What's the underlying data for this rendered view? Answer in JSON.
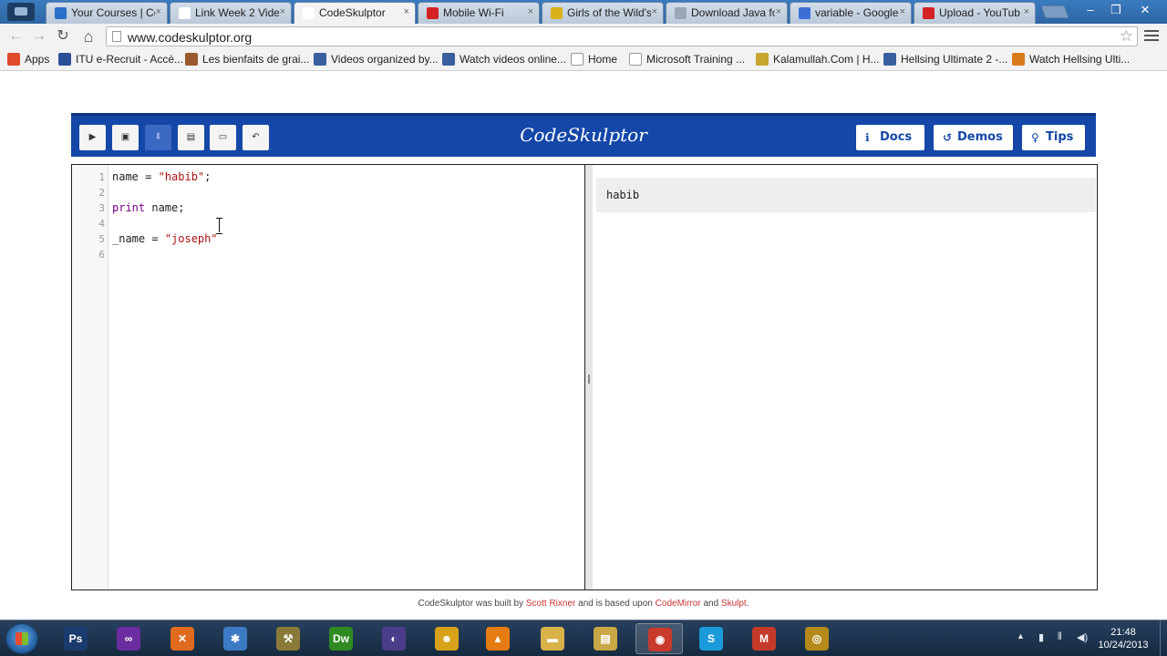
{
  "browser": {
    "tabs": [
      {
        "label": "Your Courses | Co",
        "close": "×",
        "fav_color": "#2a6fc9",
        "active": false
      },
      {
        "label": "Link Week 2 Vide",
        "close": "×",
        "fav_color": "#ffffff",
        "active": false
      },
      {
        "label": "CodeSkulptor",
        "close": "×",
        "fav_color": "#ffffff",
        "active": true
      },
      {
        "label": "Mobile Wi-Fi",
        "close": "×",
        "fav_color": "#d32222",
        "active": false
      },
      {
        "label": "Girls of the Wild's",
        "close": "×",
        "fav_color": "#d8b11a",
        "active": false
      },
      {
        "label": "Download Java fo",
        "close": "×",
        "fav_color": "#9aa6b8",
        "active": false
      },
      {
        "label": "variable - Google",
        "close": "×",
        "fav_color": "#3b6fd6",
        "active": false
      },
      {
        "label": "Upload - YouTub",
        "close": "×",
        "fav_color": "#d32222",
        "active": false
      }
    ],
    "window_buttons": {
      "minimize": "–",
      "restore": "❐",
      "close": "✕"
    },
    "nav": {
      "back": "←",
      "forward": "→",
      "reload": "↻",
      "home": "⌂"
    },
    "address": "www.codeskulptor.org",
    "bookmark_star": "☆",
    "bookmarks": [
      {
        "label": "Apps",
        "icon_color": "#e04a2b"
      },
      {
        "label": "ITU e-Recruit - Accè...",
        "icon_color": "#2c4f9a"
      },
      {
        "label": "Les bienfaits de grai...",
        "icon_color": "#9a5a2b"
      },
      {
        "label": "Videos organized by...",
        "icon_color": "#3a5f9e"
      },
      {
        "label": "Watch videos online...",
        "icon_color": "#3a5f9e"
      },
      {
        "label": "Home",
        "icon_color": "#ffffff"
      },
      {
        "label": "Microsoft Training ...",
        "icon_color": "#ffffff"
      },
      {
        "label": "Kalamullah.Com | H...",
        "icon_color": "#c8a630"
      },
      {
        "label": "Hellsing Ultimate 2 -...",
        "icon_color": "#3a5f9e"
      },
      {
        "label": "Watch Hellsing Ulti...",
        "icon_color": "#d97a1c"
      }
    ]
  },
  "app": {
    "logo": "CodeSkulptor",
    "toolbar_buttons": [
      {
        "name": "run-button",
        "glyph": "▶",
        "pressed": false
      },
      {
        "name": "save-button",
        "glyph": "▣",
        "pressed": false
      },
      {
        "name": "download-button",
        "glyph": "⬇",
        "pressed": true
      },
      {
        "name": "fresh-url-button",
        "glyph": "▤",
        "pressed": false
      },
      {
        "name": "open-local-button",
        "glyph": "▭",
        "pressed": false
      },
      {
        "name": "reset-button",
        "glyph": "↶",
        "pressed": false
      }
    ],
    "header_buttons": [
      {
        "name": "docs-button",
        "icon": "ℹ",
        "label": "Docs"
      },
      {
        "name": "demos-button",
        "icon": "↺",
        "label": "Demos"
      },
      {
        "name": "tips-button",
        "icon": "♀",
        "label": "Tips"
      }
    ],
    "accent_color": "#1447a8",
    "editor": {
      "lines": [
        {
          "num": "1",
          "segments": [
            {
              "t": "name = ",
              "c": ""
            },
            {
              "t": "\"habib\"",
              "c": "str"
            },
            {
              "t": ";",
              "c": ""
            }
          ]
        },
        {
          "num": "2",
          "segments": []
        },
        {
          "num": "3",
          "segments": [
            {
              "t": "print",
              "c": "kw"
            },
            {
              "t": " name;",
              "c": ""
            }
          ]
        },
        {
          "num": "4",
          "segments": []
        },
        {
          "num": "5",
          "segments": [
            {
              "t": "_name = ",
              "c": ""
            },
            {
              "t": "\"joseph\"",
              "c": "str"
            }
          ]
        },
        {
          "num": "6",
          "segments": []
        }
      ]
    },
    "console": {
      "output": "habib"
    },
    "footer": {
      "prefix": "CodeSkulptor was built by ",
      "author": "Scott Rixner",
      "middle": " and is based upon ",
      "lib1": "CodeMirror",
      "and": " and ",
      "lib2": "Skulpt",
      "suffix": "."
    }
  },
  "taskbar": {
    "apps": [
      {
        "name": "photoshop",
        "glyph": "Ps",
        "color": "#1a3b6e",
        "active": false
      },
      {
        "name": "visual-studio",
        "glyph": "∞",
        "color": "#6b2c9f",
        "active": false
      },
      {
        "name": "xampp",
        "glyph": "✕",
        "color": "#e06b1f",
        "active": false
      },
      {
        "name": "tools",
        "glyph": "✱",
        "color": "#3d7ac4",
        "active": false
      },
      {
        "name": "tool-kit",
        "glyph": "⚒",
        "color": "#8a7a3a",
        "active": false
      },
      {
        "name": "dreamweaver",
        "glyph": "Dw",
        "color": "#2f8a22",
        "active": false
      },
      {
        "name": "eclipse",
        "glyph": "◐",
        "color": "#4b3d8a",
        "active": false
      },
      {
        "name": "messenger",
        "glyph": "☻",
        "color": "#d7a21a",
        "active": false
      },
      {
        "name": "vlc",
        "glyph": "▲",
        "color": "#e57c12",
        "active": false
      },
      {
        "name": "folder",
        "glyph": "▬",
        "color": "#d9b24a",
        "active": false
      },
      {
        "name": "explorer",
        "glyph": "▤",
        "color": "#c9a646",
        "active": false
      },
      {
        "name": "chrome",
        "glyph": "◉",
        "color": "#c73a2c",
        "active": true
      },
      {
        "name": "skype",
        "glyph": "S",
        "color": "#1a9ad9",
        "active": false
      },
      {
        "name": "gmail",
        "glyph": "M",
        "color": "#c33a2b",
        "active": false
      },
      {
        "name": "media-player",
        "glyph": "◎",
        "color": "#b58a1a",
        "active": false
      }
    ],
    "tray": {
      "arrow": "▲",
      "battery": "▮",
      "signal": "⫴",
      "volume": "◀)"
    },
    "time": "21:48",
    "date": "10/24/2013"
  }
}
